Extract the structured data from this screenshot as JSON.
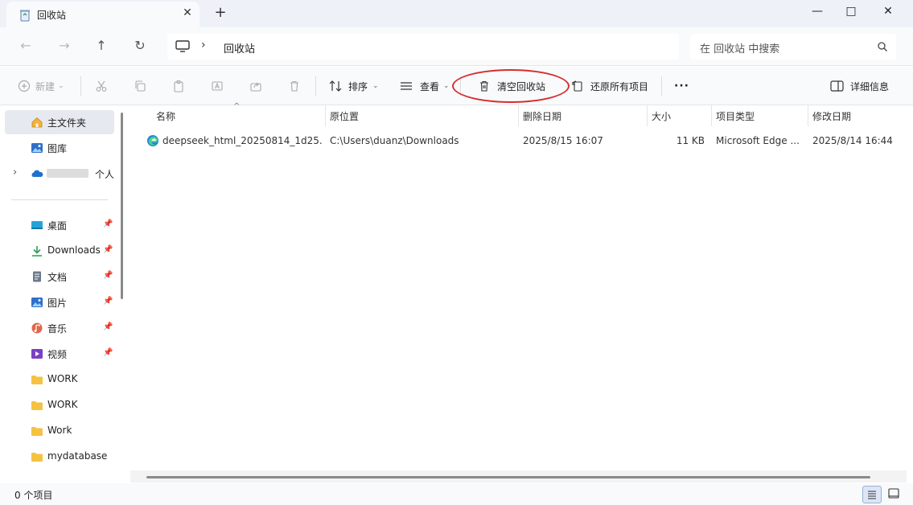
{
  "window": {
    "tab_title": "回收站",
    "tab_close": "✕",
    "new_tab": "+",
    "minimize": "—",
    "maximize": "□",
    "close": "✕"
  },
  "address": {
    "back": "←",
    "forward": "→",
    "up": "↑",
    "refresh": "↻",
    "separator": "›",
    "location": "回收站",
    "search_placeholder": "在 回收站 中搜索"
  },
  "toolbar": {
    "new_label": "新建",
    "sort_label": "排序",
    "view_label": "查看",
    "empty_bin_label": "清空回收站",
    "restore_all_label": "还原所有项目",
    "more_label": "···",
    "details_label": "详细信息"
  },
  "sidebar": {
    "items": [
      {
        "label": "主文件夹",
        "icon": "home-icon",
        "pinned": false
      },
      {
        "label": "图库",
        "icon": "gallery-icon",
        "pinned": false
      },
      {
        "label": "个人",
        "icon": "onedrive-icon",
        "pinned": false
      },
      {
        "label": "桌面",
        "icon": "desktop-icon",
        "pinned": true
      },
      {
        "label": "Downloads",
        "icon": "download-icon",
        "pinned": true
      },
      {
        "label": "文档",
        "icon": "document-icon",
        "pinned": true
      },
      {
        "label": "图片",
        "icon": "pictures-icon",
        "pinned": true
      },
      {
        "label": "音乐",
        "icon": "music-icon",
        "pinned": true
      },
      {
        "label": "视频",
        "icon": "video-icon",
        "pinned": true
      },
      {
        "label": "WORK",
        "icon": "folder-icon",
        "pinned": false
      },
      {
        "label": "WORK",
        "icon": "folder-icon",
        "pinned": false
      },
      {
        "label": "Work",
        "icon": "folder-icon",
        "pinned": false
      },
      {
        "label": "mydatabase",
        "icon": "folder-icon",
        "pinned": false
      }
    ],
    "expand_arrow": "›",
    "pin_glyph": "📌"
  },
  "columns": {
    "name": "名称",
    "original_location": "原位置",
    "date_deleted": "删除日期",
    "size": "大小",
    "item_type": "项目类型",
    "date_modified": "修改日期",
    "sort_arrow": "^"
  },
  "files": [
    {
      "name": "deepseek_html_20250814_1d25...",
      "original_location": "C:\\Users\\duanz\\Downloads",
      "date_deleted": "2025/8/15 16:07",
      "size": "11 KB",
      "item_type": "Microsoft Edge ...",
      "date_modified": "2025/8/14 16:44"
    }
  ],
  "status": {
    "item_count": "0 个项目"
  },
  "colors": {
    "highlight_ring": "#d62e2e",
    "accent": "#1a73e8"
  }
}
